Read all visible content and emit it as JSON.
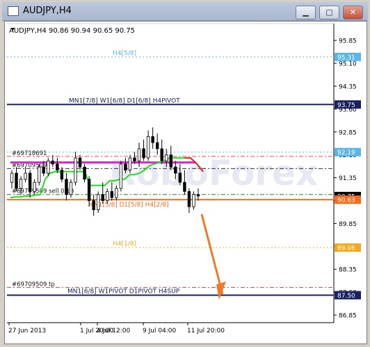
{
  "window": {
    "title": "AUDJPY,H4",
    "minimize": "▁",
    "maximize": "▢",
    "close": "✕"
  },
  "chart_header": "AUDJPY,H4  90.86 90.94 90.65 90.75",
  "chart_data": {
    "type": "candlestick",
    "symbol": "AUDJPY",
    "timeframe": "H4",
    "ohlc_last": {
      "open": 90.86,
      "high": 90.94,
      "low": 90.65,
      "close": 90.75
    },
    "ylim": [
      86.6,
      96.4
    ],
    "y_ticks": [
      "95.85",
      "95.10",
      "94.35",
      "93.60",
      "92.85",
      "92.10",
      "91.35",
      "90.60",
      "89.85",
      "89.10",
      "88.35",
      "87.60",
      "86.85"
    ],
    "x_ticks": [
      "27 Jun 2013",
      "1 Jul 20:00",
      "4 Jul 12:00",
      "9 Jul 04:00",
      "11 Jul 20:00"
    ],
    "price_tags": [
      {
        "value": 95.31,
        "label": "95.31",
        "color": "#5bb6e8"
      },
      {
        "value": 93.75,
        "label": "93.75",
        "color": "#1a2060"
      },
      {
        "value": 92.19,
        "label": "92.19",
        "color": "#5bb6e8"
      },
      {
        "value": 90.75,
        "label": "90.75",
        "color": "#000000"
      },
      {
        "value": 90.63,
        "label": "90.63",
        "color": "#ff6a1a"
      },
      {
        "value": 89.06,
        "label": "89.06",
        "color": "#f4a820"
      },
      {
        "value": 87.5,
        "label": "87.50",
        "color": "#1a2060"
      }
    ],
    "levels": [
      {
        "value": 95.31,
        "label": "H4[5/8]",
        "color": "#5bb6e8",
        "style": "dot"
      },
      {
        "value": 93.75,
        "label": "MN1[7/8] W1[6/8] D1[6/8] H4PIVOT",
        "color": "#1a2060",
        "style": "solid"
      },
      {
        "value": 92.19,
        "label": "",
        "color": "#5bb6e8",
        "style": "dot"
      },
      {
        "value": 90.63,
        "label": "MN1[5/8] D1[5/8] H4[2/8]",
        "color": "#ff6a1a",
        "style": "solid"
      },
      {
        "value": 89.06,
        "label": "H4[1/8]",
        "color": "#f4a820",
        "style": "dot"
      },
      {
        "value": 87.5,
        "label": "MN1[6/8] W1PIVOT D1PIVOT H4SUP",
        "color": "#1a2060",
        "style": "solid"
      }
    ],
    "order_lines": [
      {
        "value": 92.05,
        "label": "#69718691",
        "color": "#ff4040"
      },
      {
        "value": 91.65,
        "label": "#69709509",
        "color": "#303030"
      },
      {
        "value": 90.8,
        "label": "#69709509 sell 0.10",
        "color": "#208020"
      },
      {
        "value": 87.75,
        "label": "#69709509 tp",
        "color": "#ff4040"
      }
    ],
    "candles": [
      [
        91.2,
        91.6,
        91.0,
        91.5
      ],
      [
        91.5,
        91.7,
        90.9,
        91.0
      ],
      [
        91.0,
        91.4,
        90.8,
        91.3
      ],
      [
        91.3,
        91.7,
        91.2,
        91.5
      ],
      [
        91.5,
        91.6,
        90.7,
        90.9
      ],
      [
        90.9,
        91.3,
        90.8,
        91.2
      ],
      [
        91.2,
        91.8,
        91.1,
        91.7
      ],
      [
        91.7,
        91.9,
        91.4,
        91.5
      ],
      [
        91.5,
        92.0,
        91.4,
        91.9
      ],
      [
        91.9,
        92.1,
        91.7,
        91.8
      ],
      [
        91.8,
        92.0,
        91.5,
        91.6
      ],
      [
        91.6,
        91.7,
        91.2,
        91.3
      ],
      [
        91.3,
        91.5,
        90.6,
        90.8
      ],
      [
        90.8,
        91.3,
        90.7,
        91.2
      ],
      [
        91.2,
        92.2,
        91.1,
        92.0
      ],
      [
        92.0,
        92.1,
        91.6,
        91.7
      ],
      [
        91.7,
        91.8,
        91.2,
        91.3
      ],
      [
        91.3,
        91.4,
        90.4,
        90.6
      ],
      [
        90.6,
        90.8,
        90.1,
        90.3
      ],
      [
        90.3,
        90.9,
        90.2,
        90.8
      ],
      [
        90.8,
        91.2,
        90.5,
        90.6
      ],
      [
        90.6,
        91.0,
        90.5,
        90.9
      ],
      [
        90.9,
        91.2,
        90.6,
        90.7
      ],
      [
        90.7,
        91.1,
        90.6,
        91.0
      ],
      [
        91.0,
        91.9,
        90.9,
        91.8
      ],
      [
        91.8,
        92.0,
        91.5,
        91.6
      ],
      [
        91.6,
        92.1,
        91.5,
        92.0
      ],
      [
        92.0,
        92.2,
        91.8,
        91.9
      ],
      [
        91.9,
        92.5,
        91.7,
        92.3
      ],
      [
        92.3,
        92.6,
        91.9,
        92.0
      ],
      [
        92.0,
        92.9,
        91.9,
        92.7
      ],
      [
        92.7,
        93.0,
        92.3,
        92.5
      ],
      [
        92.5,
        92.8,
        92.1,
        92.3
      ],
      [
        92.3,
        92.6,
        91.8,
        91.9
      ],
      [
        91.9,
        92.3,
        91.7,
        92.1
      ],
      [
        92.1,
        92.4,
        91.6,
        91.7
      ],
      [
        91.7,
        91.9,
        91.3,
        91.5
      ],
      [
        91.5,
        91.8,
        91.1,
        91.2
      ],
      [
        91.2,
        91.6,
        90.8,
        90.9
      ],
      [
        90.9,
        91.0,
        90.2,
        90.4
      ],
      [
        90.4,
        90.9,
        90.3,
        90.8
      ],
      [
        90.8,
        91.0,
        90.6,
        90.75
      ]
    ],
    "green_line": [
      90.7,
      90.72,
      90.72,
      90.75,
      90.75,
      90.78,
      90.8,
      91.3,
      91.5,
      91.55,
      91.55,
      91.55,
      91.55,
      91.55,
      91.55,
      91.55,
      91.1,
      91.1,
      91.1,
      91.1,
      91.25,
      91.25,
      91.3,
      91.3,
      91.45,
      91.45,
      91.5,
      91.6,
      91.75,
      91.8,
      91.85,
      91.9,
      92.0,
      92.0,
      92.0,
      92.0
    ],
    "red_line": [
      92.0,
      92.0,
      91.8,
      91.55
    ],
    "magenta_line": 91.85,
    "watermark": "RoboForex"
  }
}
